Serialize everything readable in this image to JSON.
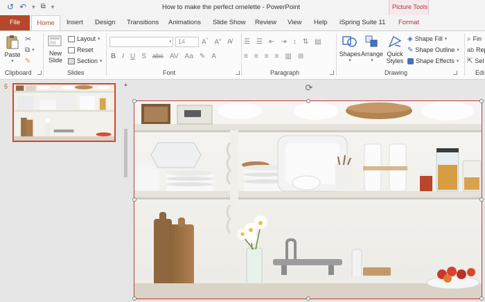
{
  "window": {
    "title": "How to make the perfect omelette  -  PowerPoint",
    "context_group": "Picture Tools"
  },
  "qat": {
    "autosave_icon": "autosave-icon",
    "undo_icon": "undo-icon",
    "start_icon": "start-from-beginning-icon",
    "customize_icon": "customize-qat-icon"
  },
  "tabs": {
    "file": "File",
    "home": "Home",
    "insert": "Insert",
    "design": "Design",
    "transitions": "Transitions",
    "animations": "Animations",
    "slideshow": "Slide Show",
    "review": "Review",
    "view": "View",
    "help": "Help",
    "ispring": "iSpring Suite 11",
    "format": "Format"
  },
  "ribbon": {
    "clipboard": {
      "label": "Clipboard",
      "paste": "Paste"
    },
    "slides": {
      "label": "Slides",
      "new_slide_line1": "New",
      "new_slide_line2": "Slide",
      "layout": "Layout",
      "reset": "Reset",
      "section": "Section"
    },
    "font": {
      "label": "Font",
      "size_placeholder": "14"
    },
    "paragraph": {
      "label": "Paragraph"
    },
    "drawing": {
      "label": "Drawing",
      "shapes": "Shapes",
      "arrange": "Arrange",
      "quick_styles_line1": "Quick",
      "quick_styles_line2": "Styles",
      "shape_fill": "Shape Fill",
      "shape_outline": "Shape Outline",
      "shape_effects": "Shape Effects"
    },
    "editing": {
      "label": "Edi",
      "find": "Fin",
      "replace": "Rep",
      "select": "Sel"
    }
  },
  "thumbnails": {
    "slide_number": "5"
  },
  "colors": {
    "accent": "#b7472a",
    "selection": "#c23b3b",
    "context_tab": "#a5373e"
  }
}
